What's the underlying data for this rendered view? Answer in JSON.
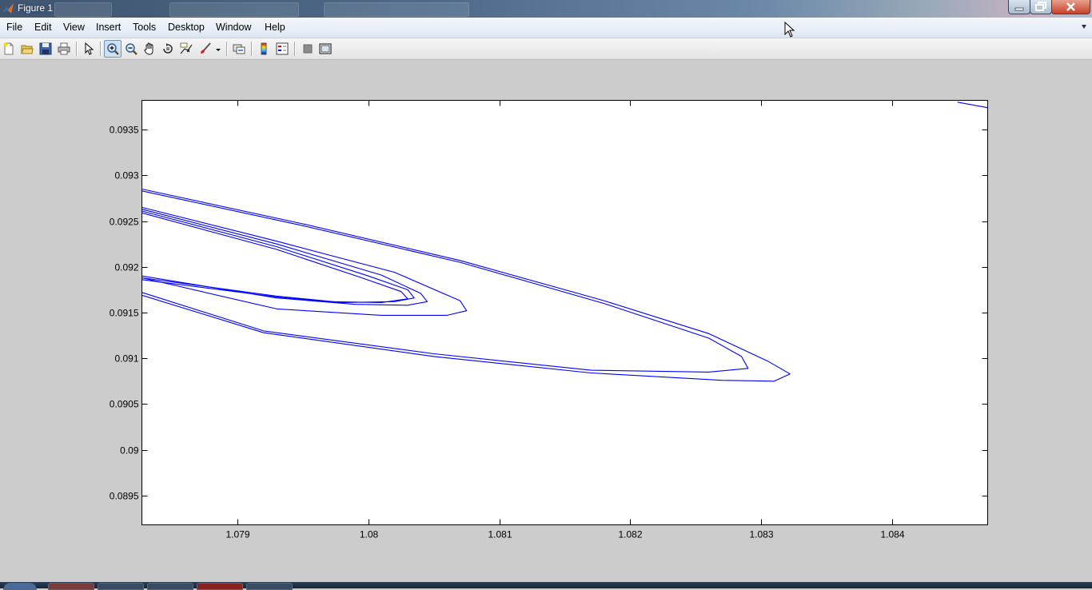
{
  "window": {
    "title": "Figure 1"
  },
  "menu": [
    {
      "id": "file",
      "label": "File"
    },
    {
      "id": "edit",
      "label": "Edit"
    },
    {
      "id": "view",
      "label": "View"
    },
    {
      "id": "insert",
      "label": "Insert"
    },
    {
      "id": "tools",
      "label": "Tools"
    },
    {
      "id": "desktop",
      "label": "Desktop"
    },
    {
      "id": "window",
      "label": "Window"
    },
    {
      "id": "help",
      "label": "Help"
    }
  ],
  "toolbar": {
    "items": [
      {
        "name": "new-figure-button",
        "icon": "new-file-icon"
      },
      {
        "name": "open-file-button",
        "icon": "folder-icon"
      },
      {
        "name": "save-figure-button",
        "icon": "floppy-icon"
      },
      {
        "name": "print-figure-button",
        "icon": "printer-icon"
      },
      {
        "name": "edit-plot-button",
        "icon": "arrow-cursor-icon"
      },
      {
        "name": "zoom-in-button",
        "icon": "zoom-in-icon",
        "pressed": true
      },
      {
        "name": "zoom-out-button",
        "icon": "zoom-out-icon"
      },
      {
        "name": "pan-button",
        "icon": "hand-icon"
      },
      {
        "name": "rotate-3d-button",
        "icon": "rotate-icon"
      },
      {
        "name": "data-cursor-button",
        "icon": "data-cursor-icon"
      },
      {
        "name": "brush-button",
        "icon": "brush-icon"
      },
      {
        "name": "link-plot-button",
        "icon": "link-icon"
      },
      {
        "name": "insert-colorbar-button",
        "icon": "colorbar-icon"
      },
      {
        "name": "insert-legend-button",
        "icon": "legend-icon"
      },
      {
        "name": "hide-plot-tools-button",
        "icon": "gray-square-icon"
      },
      {
        "name": "show-plot-tools-button",
        "icon": "plot-tools-icon"
      }
    ]
  },
  "colors": {
    "line": "#0000ff",
    "figure_bg": "#cccccc",
    "axes_bg": "#ffffff"
  },
  "chart_data": {
    "type": "line",
    "title": "",
    "xlabel": "",
    "ylabel": "",
    "xlim": [
      1.07827,
      1.08473
    ],
    "ylim": [
      0.08918,
      0.09382
    ],
    "xticks": [
      "1.079",
      "1.08",
      "1.081",
      "1.082",
      "1.083",
      "1.084"
    ],
    "yticks": [
      "0.0895",
      "0.09",
      "0.0905",
      "0.091",
      "0.0915",
      "0.092",
      "0.0925",
      "0.093",
      "0.0935"
    ],
    "grid": false,
    "series": [
      {
        "values": [
          [
            1.07827,
            0.09285
          ],
          [
            1.0795,
            0.09247
          ],
          [
            1.0807,
            0.09207
          ],
          [
            1.0818,
            0.09163
          ],
          [
            1.0826,
            0.09127
          ],
          [
            1.08305,
            0.09097
          ],
          [
            1.08322,
            0.09083
          ],
          [
            1.0831,
            0.09075
          ],
          [
            1.0827,
            0.09076
          ],
          [
            1.0817,
            0.09084
          ],
          [
            1.0805,
            0.09102
          ],
          [
            1.0792,
            0.09128
          ],
          [
            1.07827,
            0.09169
          ]
        ]
      },
      {
        "values": [
          [
            1.07827,
            0.09283
          ],
          [
            1.0795,
            0.09245
          ],
          [
            1.0807,
            0.09205
          ],
          [
            1.0818,
            0.0916
          ],
          [
            1.0826,
            0.09122
          ],
          [
            1.08285,
            0.09102
          ],
          [
            1.0829,
            0.09089
          ],
          [
            1.0826,
            0.09085
          ],
          [
            1.0817,
            0.09087
          ],
          [
            1.0805,
            0.09105
          ],
          [
            1.0792,
            0.0913
          ],
          [
            1.07827,
            0.09172
          ]
        ]
      },
      {
        "values": [
          [
            1.07827,
            0.09265
          ],
          [
            1.0793,
            0.09228
          ],
          [
            1.0802,
            0.09194
          ],
          [
            1.0807,
            0.09163
          ],
          [
            1.08075,
            0.09152
          ],
          [
            1.0806,
            0.09147
          ],
          [
            1.0801,
            0.09147
          ],
          [
            1.0793,
            0.09154
          ],
          [
            1.07827,
            0.09188
          ]
        ]
      },
      {
        "values": [
          [
            1.07827,
            0.09263
          ],
          [
            1.0793,
            0.09225
          ],
          [
            1.0801,
            0.09191
          ],
          [
            1.0804,
            0.09171
          ],
          [
            1.08045,
            0.09162
          ],
          [
            1.0803,
            0.09158
          ],
          [
            1.0799,
            0.09159
          ],
          [
            1.0793,
            0.09166
          ],
          [
            1.07827,
            0.0919
          ]
        ]
      },
      {
        "values": [
          [
            1.07827,
            0.09261
          ],
          [
            1.0793,
            0.09222
          ],
          [
            1.08,
            0.0919
          ],
          [
            1.0803,
            0.09175
          ],
          [
            1.08035,
            0.09166
          ],
          [
            1.0802,
            0.09162
          ],
          [
            1.0798,
            0.09161
          ],
          [
            1.0793,
            0.09168
          ],
          [
            1.07827,
            0.09188
          ]
        ]
      },
      {
        "values": [
          [
            1.07827,
            0.09259
          ],
          [
            1.0793,
            0.09219
          ],
          [
            1.07995,
            0.09188
          ],
          [
            1.08025,
            0.09173
          ],
          [
            1.0803,
            0.09165
          ],
          [
            1.0801,
            0.09161
          ],
          [
            1.0797,
            0.09162
          ],
          [
            1.0793,
            0.09167
          ],
          [
            1.07827,
            0.09186
          ]
        ]
      },
      {
        "values": [
          [
            1.0845,
            0.0938
          ],
          [
            1.08473,
            0.09374
          ]
        ]
      }
    ]
  }
}
